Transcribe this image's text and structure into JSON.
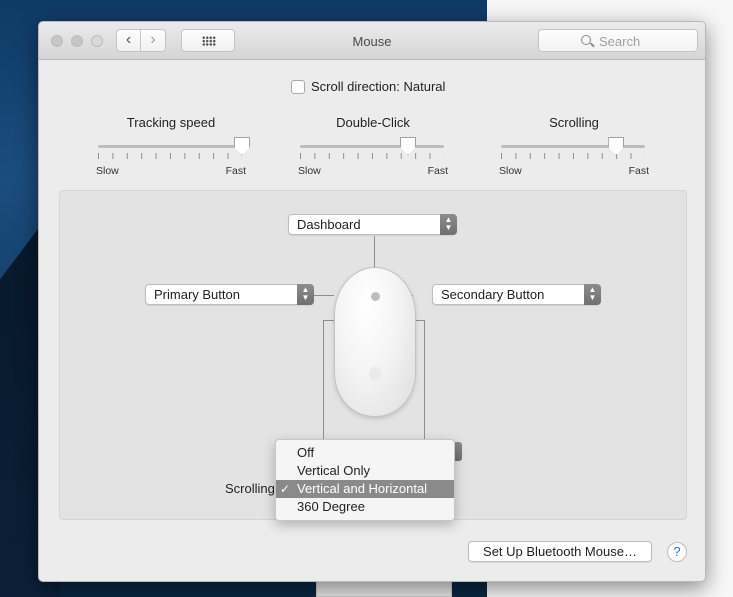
{
  "window": {
    "title": "Mouse",
    "nav_back_icon": "chevron-left-icon",
    "nav_forward_icon": "chevron-right-icon",
    "grid_icon": "show-all-grid-icon",
    "search_placeholder": "Search"
  },
  "options": {
    "scroll_direction_label": "Scroll direction: Natural",
    "scroll_direction_checked": false
  },
  "sliders": [
    {
      "title": "Tracking speed",
      "min_label": "Slow",
      "max_label": "Fast",
      "value_fraction": 1.0
    },
    {
      "title": "Double-Click",
      "min_label": "Slow",
      "max_label": "Fast",
      "value_fraction": 0.75
    },
    {
      "title": "Scrolling",
      "min_label": "Slow",
      "max_label": "Fast",
      "value_fraction": 0.8
    }
  ],
  "buttons_config": {
    "top": "Dashboard",
    "left": "Primary Button",
    "right": "Secondary Button",
    "scrolling_label": "Scrolling"
  },
  "scrolling_menu": {
    "items": [
      "Off",
      "Vertical Only",
      "Vertical and Horizontal",
      "360 Degree"
    ],
    "selected_index": 2,
    "check_glyph": "✓"
  },
  "footer": {
    "bluetooth_button": "Set Up Bluetooth Mouse…",
    "help_glyph": "?"
  },
  "colors": {
    "accent_selected": "#8a8a8a",
    "help_blue": "#2a6fd6"
  }
}
